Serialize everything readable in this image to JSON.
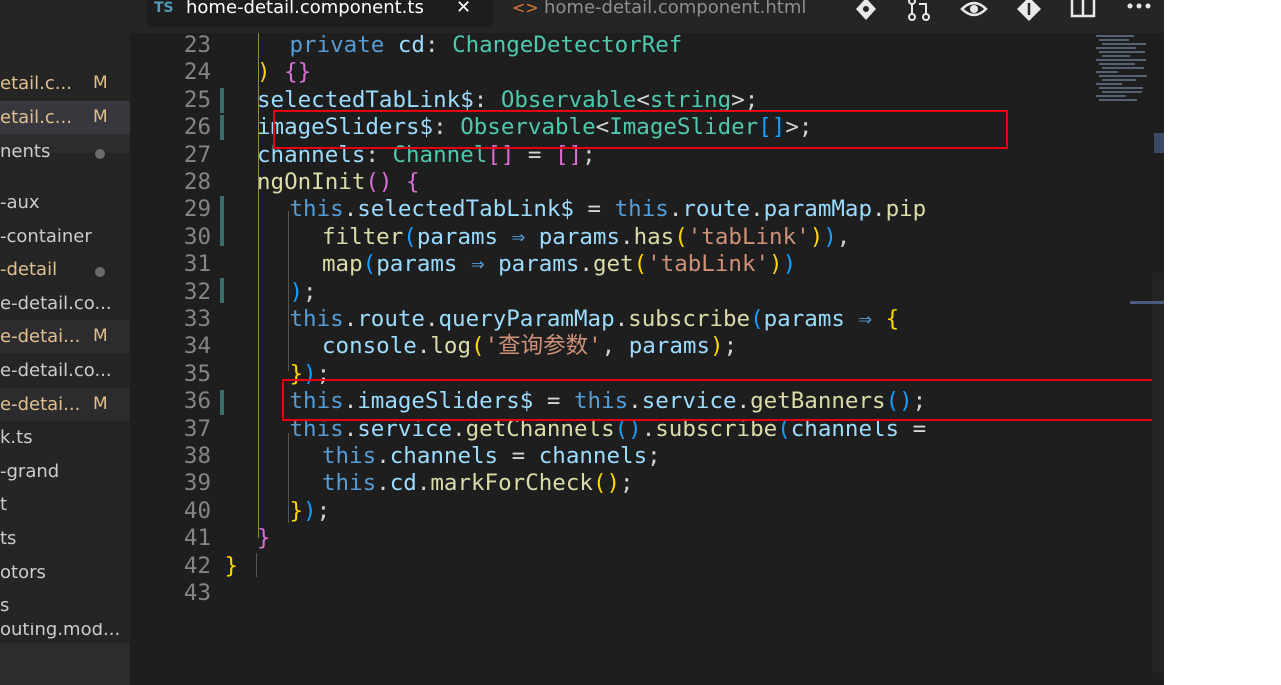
{
  "tabs": [
    {
      "icon": "TS",
      "label": "home-detail.component.ts",
      "close": "✕",
      "active": true
    },
    {
      "icon": "<>",
      "label": "home-detail.component.html",
      "active": false
    }
  ],
  "toolbar_icons": [
    "git-compare-icon",
    "git-pull-request-icon",
    "preview-eye-icon",
    "git-commit-icon",
    "split-editor-icon",
    "more-actions-icon"
  ],
  "sidebar": {
    "items": [
      {
        "label": "etail.c...",
        "badge": "M",
        "modified": true
      },
      {
        "label": "etail.c...",
        "badge": "M",
        "modified": true
      },
      {
        "label": "nents",
        "dot": true
      },
      {
        "label": "-aux"
      },
      {
        "label": "-container"
      },
      {
        "label": "-detail",
        "dot": true,
        "modified": true
      },
      {
        "label": "e-detail.co..."
      },
      {
        "label": "e-detai...",
        "badge": "M",
        "modified": true
      },
      {
        "label": "e-detail.co..."
      },
      {
        "label": "e-detai...",
        "badge": "M",
        "modified": true
      },
      {
        "label": "k.ts"
      },
      {
        "label": "-grand"
      },
      {
        "label": "t"
      },
      {
        "label": "ts"
      },
      {
        "label": "otors"
      },
      {
        "label": "s"
      },
      {
        "label": "outing.mod..."
      }
    ]
  },
  "editor": {
    "line_numbers": [
      "23",
      "24",
      "25",
      "26",
      "27",
      "28",
      "29",
      "30",
      "31",
      "32",
      "33",
      "34",
      "35",
      "36",
      "37",
      "38",
      "39",
      "40",
      "41",
      "42",
      "43"
    ],
    "lines": [
      [
        "private",
        " ",
        "cd",
        ": ",
        "ChangeDetectorRef"
      ],
      [
        ")",
        " ",
        "{",
        "}"
      ],
      [
        "selectedTabLink$",
        ": ",
        "Observable",
        "<",
        "string",
        ">",
        ";"
      ],
      [
        "imageSliders$",
        ": ",
        "Observable",
        "<",
        "ImageSlider",
        "[",
        "]",
        ">",
        ";"
      ],
      [
        "channels",
        ": ",
        "Channel",
        "[",
        "]",
        " = ",
        "[",
        "]",
        ";"
      ],
      [
        "ngOnInit",
        "(",
        ")",
        " ",
        "{"
      ],
      [
        "this",
        ".",
        "selectedTabLink$",
        " = ",
        "this",
        ".",
        "route",
        ".",
        "paramMap",
        ".",
        "pip"
      ],
      [
        "filter",
        "(",
        "params",
        " ⇒ ",
        "params",
        ".",
        "has",
        "(",
        "'tabLink'",
        ")",
        ")",
        ","
      ],
      [
        "map",
        "(",
        "params",
        " ⇒ ",
        "params",
        ".",
        "get",
        "(",
        "'tabLink'",
        ")",
        ")"
      ],
      [
        ")",
        ";"
      ],
      [
        "this",
        ".",
        "route",
        ".",
        "queryParamMap",
        ".",
        "subscribe",
        "(",
        "params",
        " ⇒ ",
        "{"
      ],
      [
        "console",
        ".",
        "log",
        "(",
        "'查询参数'",
        ", ",
        "params",
        ")",
        ";"
      ],
      [
        "}",
        ")",
        ";"
      ],
      [
        "this",
        ".",
        "imageSliders$",
        " = ",
        "this",
        ".",
        "service",
        ".",
        "getBanners",
        "(",
        ")",
        ";"
      ],
      [
        "this",
        ".",
        "service",
        ".",
        "getChannels",
        "(",
        ")",
        ".",
        "subscribe",
        "(",
        "channels",
        " ="
      ],
      [
        "this",
        ".",
        "channels",
        " = ",
        "channels",
        ";"
      ],
      [
        "this",
        ".",
        "cd",
        ".",
        "markForCheck",
        "(",
        ")",
        ";"
      ],
      [
        "}",
        ")",
        ";"
      ],
      [
        "}"
      ],
      [
        "}"
      ],
      []
    ]
  },
  "colors": {
    "highlight_box": "#e60012",
    "keyword": "#569cd6",
    "type": "#4ec9b0",
    "variable": "#9cdcfe",
    "function": "#dcdcaa",
    "string": "#ce9178"
  }
}
